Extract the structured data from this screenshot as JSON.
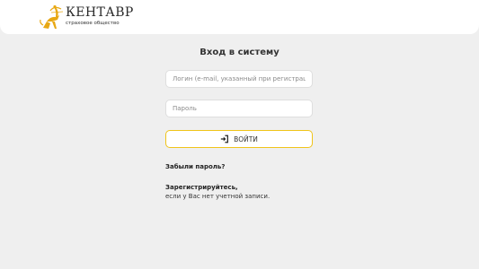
{
  "header": {
    "brand_name": "КЕНТАВР",
    "brand_subtitle": "страховое общество",
    "logo_icon": "centaur-logo-icon",
    "logo_color": "#e8a813"
  },
  "login": {
    "title": "Вход в систему",
    "login_placeholder": "Логин (e-mail, указанный при регистрации)",
    "password_placeholder": "Пароль",
    "submit_label": "ВОЙТИ",
    "submit_icon": "sign-in-icon",
    "button_border_color": "#f0c419",
    "forgot_password": "Забыли пароль?",
    "register_link": "Зарегистрируйтесь,",
    "register_note": "если у Вас нет учетной записи."
  }
}
